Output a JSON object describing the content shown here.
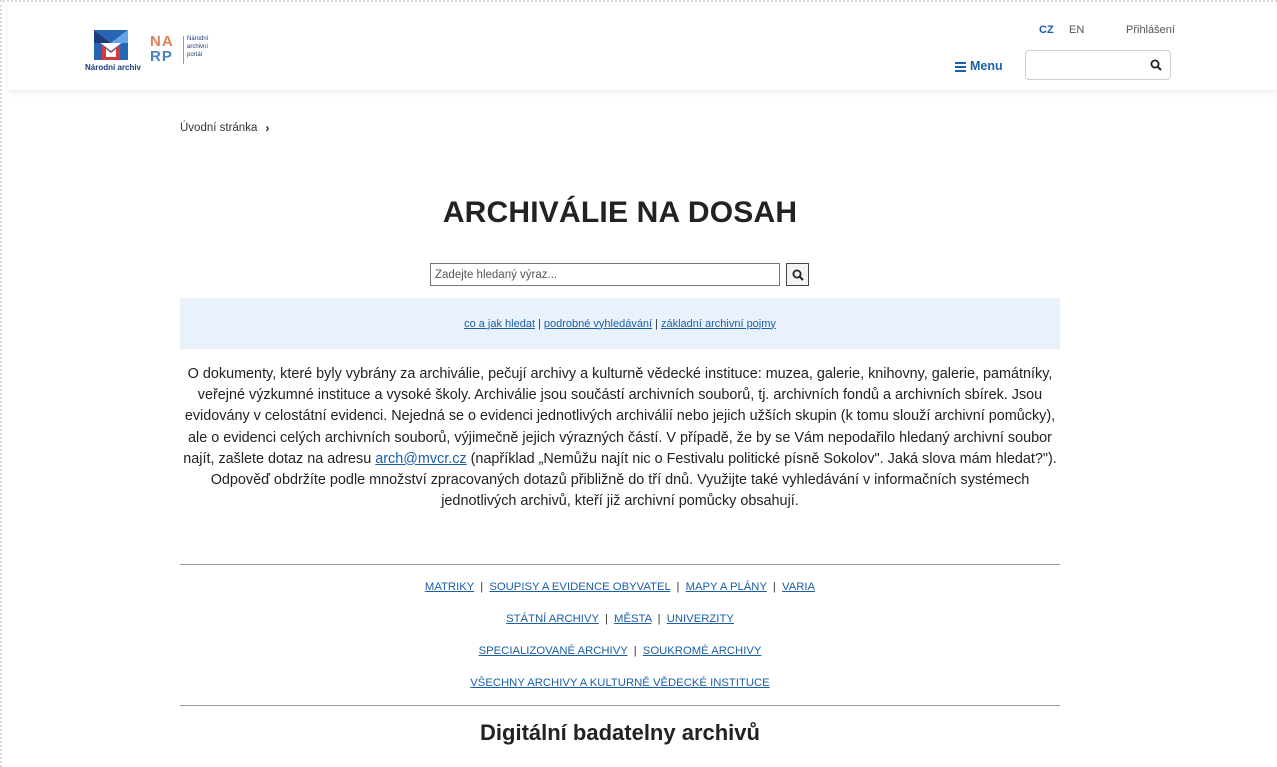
{
  "header": {
    "logo_na_caption": "Národní archiv",
    "logo_narp_letters": [
      "NA",
      "RP"
    ],
    "logo_narp_caption": [
      "Národní",
      "archivní",
      "portál"
    ],
    "lang_cz": "CZ",
    "lang_en": "EN",
    "login": "Přihlášení",
    "menu_label": "Menu",
    "search_value": "",
    "brand_blue": "#1a5fa8"
  },
  "breadcrumb": {
    "home": "Úvodní stránka",
    "separator": "›"
  },
  "main": {
    "title": "ARCHIVÁLIE NA DOSAH",
    "search_placeholder": "Zadejte hledaný výraz...",
    "help_links": [
      "co a jak hledat",
      "podrobné vyhledávání",
      "základní archivní pojmy"
    ],
    "intro_before_email": "O dokumenty, které byly vybrány za archiválie, pečují archivy a kulturně vědecké instituce: muzea, galerie, knihovny, galerie, památníky, veřejné výzkumné instituce a vysoké školy. Archiválie jsou součástí archivních souborů, tj. archivních fondů a archivních sbírek. Jsou evidovány v celostátní evidenci. Nejedná se o evidenci jednotlivých archiválií nebo jejich užších skupin (k tomu slouží archivní pomůcky), ale o evidenci celých archivních souborů, výjimečně jejich výrazných částí. V případě, že by se Vám nepodařilo hledaný archivní soubor najít, zašlete dotaz na adresu",
    "intro_email": "arch@mvcr.cz",
    "intro_after_email": "(například „Nemůžu najít nic o Festivalu politické písně Sokolov\". Jaká slova mám hledat?\"). Odpověď obdržíte podle množství zpracovaných dotazů přibližně do tří dnů. Využijte také vyhledávání v informačních systémech jednotlivých archivů, kteří již archivní pomůcky obsahují.",
    "link_rows": [
      [
        "MATRIKY",
        "SOUPISY A EVIDENCE OBYVATEL",
        "MAPY A PLÁNY",
        "VARIA"
      ],
      [
        "STÁTNÍ ARCHIVY",
        "MĚSTA",
        "UNIVERZITY"
      ],
      [
        "SPECIALIZOVANÉ ARCHIVY",
        "SOUKROMÉ ARCHIVY"
      ],
      [
        "VŠECHNY ARCHIVY A KULTURNĚ VĚDECKÉ INSTITUCE"
      ]
    ],
    "subtitle": "Digitální badatelny archivů",
    "separator_char": "|"
  }
}
